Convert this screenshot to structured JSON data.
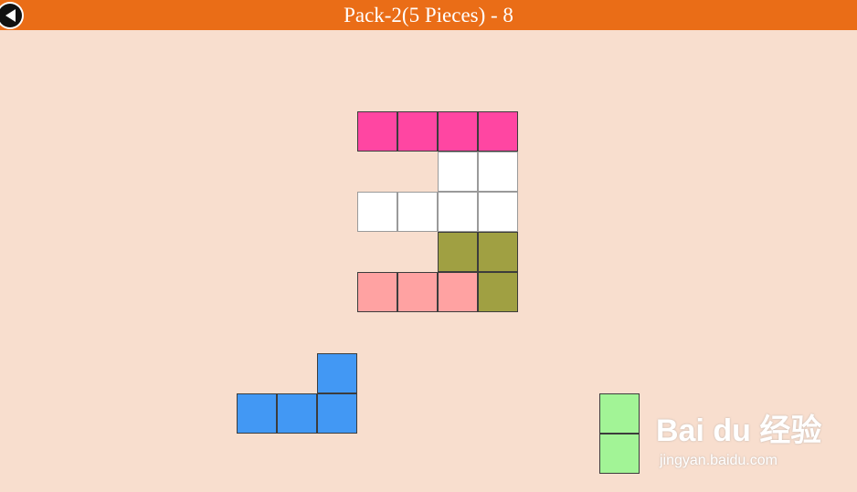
{
  "header": {
    "title": "Pack-2(5 Pieces)  - 8",
    "back_icon": "back-arrow-icon",
    "bar_color": "#ea6d17"
  },
  "board": {
    "empty_cell_color": "#ffffff"
  },
  "pieces": [
    {
      "name": "magenta-piece",
      "color": "#ff46a2",
      "state": "placed"
    },
    {
      "name": "olive-piece",
      "color": "#a0a042",
      "state": "placed"
    },
    {
      "name": "pink-piece",
      "color": "#ffa2a2",
      "state": "placed"
    },
    {
      "name": "blue-piece",
      "color": "#4298f4",
      "state": "tray"
    },
    {
      "name": "green-piece",
      "color": "#a2f496",
      "state": "tray"
    }
  ],
  "watermark": {
    "brand": "Bai du 经验",
    "url": "jingyan.baidu.com"
  }
}
